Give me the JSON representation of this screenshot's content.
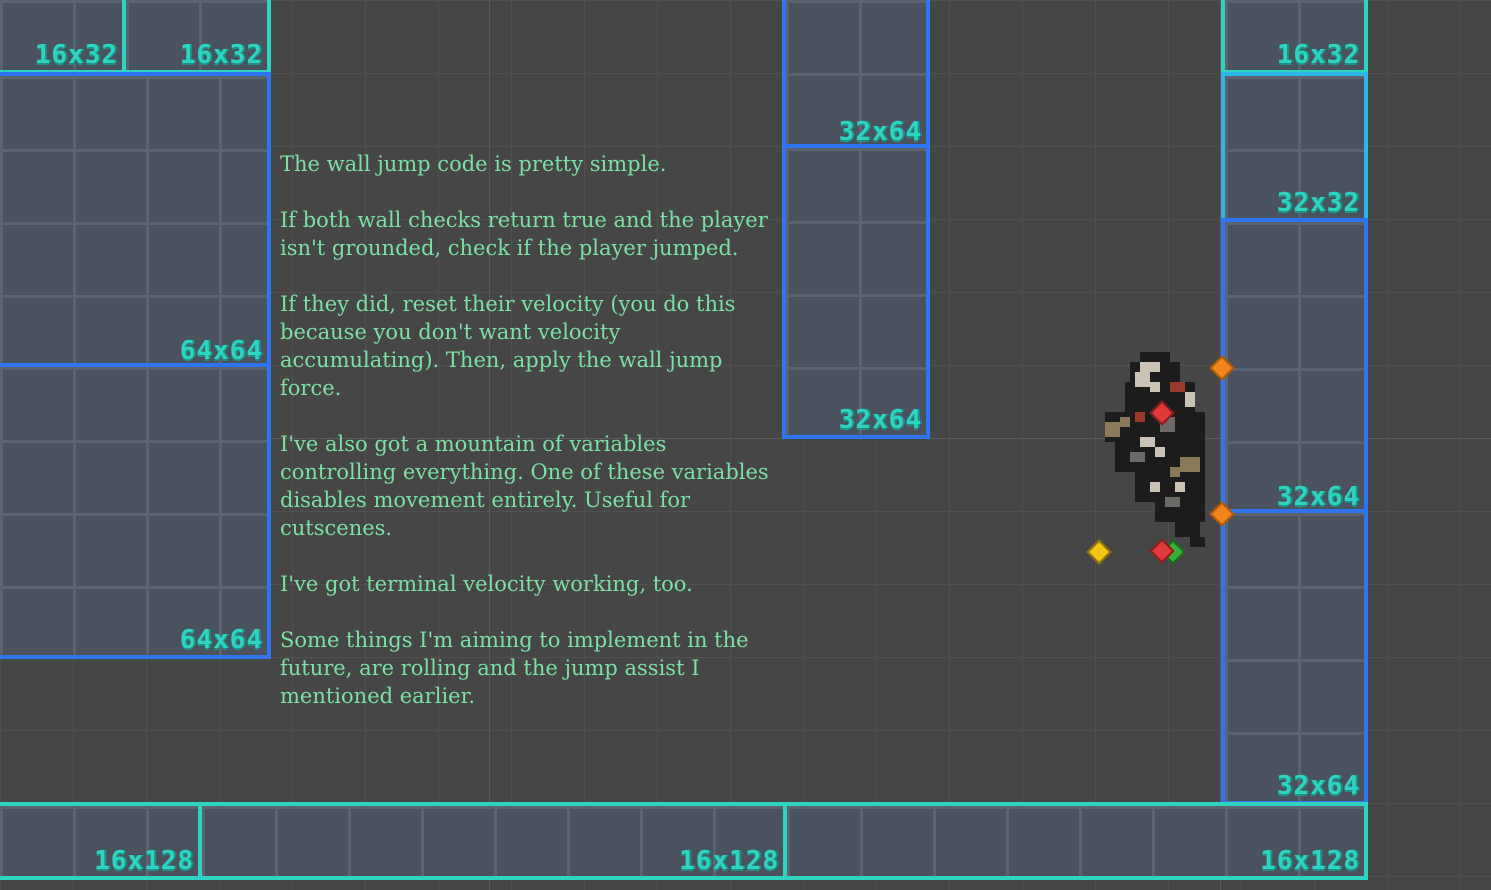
{
  "labels": {
    "top_left_1": "16x32",
    "top_left_2": "16x32",
    "left_upper": "64x64",
    "left_lower": "64x64",
    "center_upper": "32x64",
    "center_lower": "32x64",
    "right_top": "16x32",
    "right_mid": "32x32",
    "right_upper": "32x64",
    "right_lower": "32x64",
    "bottom_1": "16x128",
    "bottom_2": "16x128",
    "bottom_3": "16x128"
  },
  "notes": {
    "p1": "The wall jump code is pretty simple.",
    "p2": "If both wall checks return true and the player isn't grounded, check if the player jumped.",
    "p3": "If they did, reset their velocity (you do this because you don't want velocity accumulating). Then, apply the wall jump force.",
    "p4": "I've also got a mountain of variables controlling everything. One of these variables disables movement entirely. Useful for cutscenes.",
    "p5": "I've got terminal velocity working, too.",
    "p6": "Some things I'm aiming to implement in the future, are rolling and the jump assist I mentioned earlier."
  },
  "colors": {
    "background": "#464646",
    "tile_fill": "#4a5260",
    "teal_outline": "#2ed3c1",
    "blue_outline": "#2f74f0",
    "text": "#7be0a3"
  },
  "markers": {
    "gizmo_icons": [
      "orange-diamond-icon",
      "red-diamond-icon",
      "yellow-diamond-icon",
      "green-diamond-icon"
    ]
  }
}
